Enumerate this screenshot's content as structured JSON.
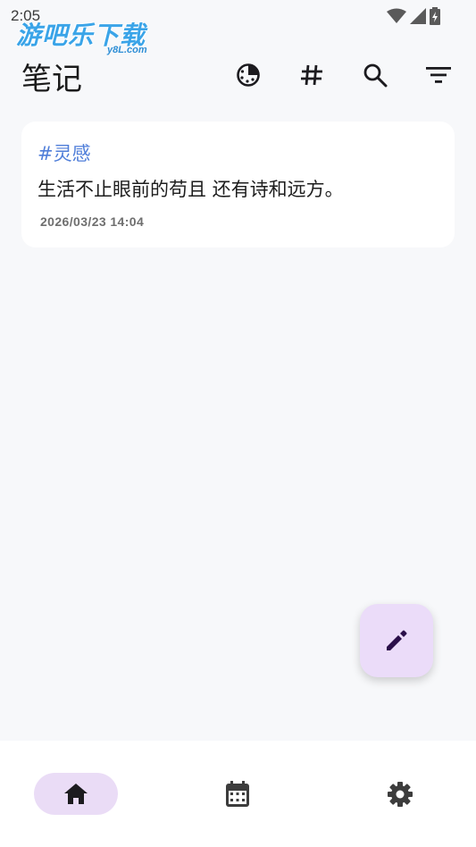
{
  "status_bar": {
    "time": "2:05"
  },
  "watermark": {
    "text": "游吧乐下载",
    "sub": "y8L.com"
  },
  "appbar": {
    "title": "笔记"
  },
  "notes": [
    {
      "tag": "#灵感",
      "content": "生活不止眼前的苟且 还有诗和远方。",
      "timestamp": "2026/03/23 14:04"
    }
  ],
  "colors": {
    "accent": "#4f7ed9",
    "fab_bg": "#ebdcf9",
    "nav_active_bg": "#eadcf6",
    "icon": "#1c1b1f"
  },
  "icons": {
    "appbar": [
      "timer-icon",
      "hashtag-icon",
      "search-icon",
      "filter-icon"
    ],
    "fab": "edit-icon",
    "nav": [
      "home-icon",
      "calendar-icon",
      "settings-icon"
    ]
  },
  "nav": {
    "active_index": 0
  }
}
